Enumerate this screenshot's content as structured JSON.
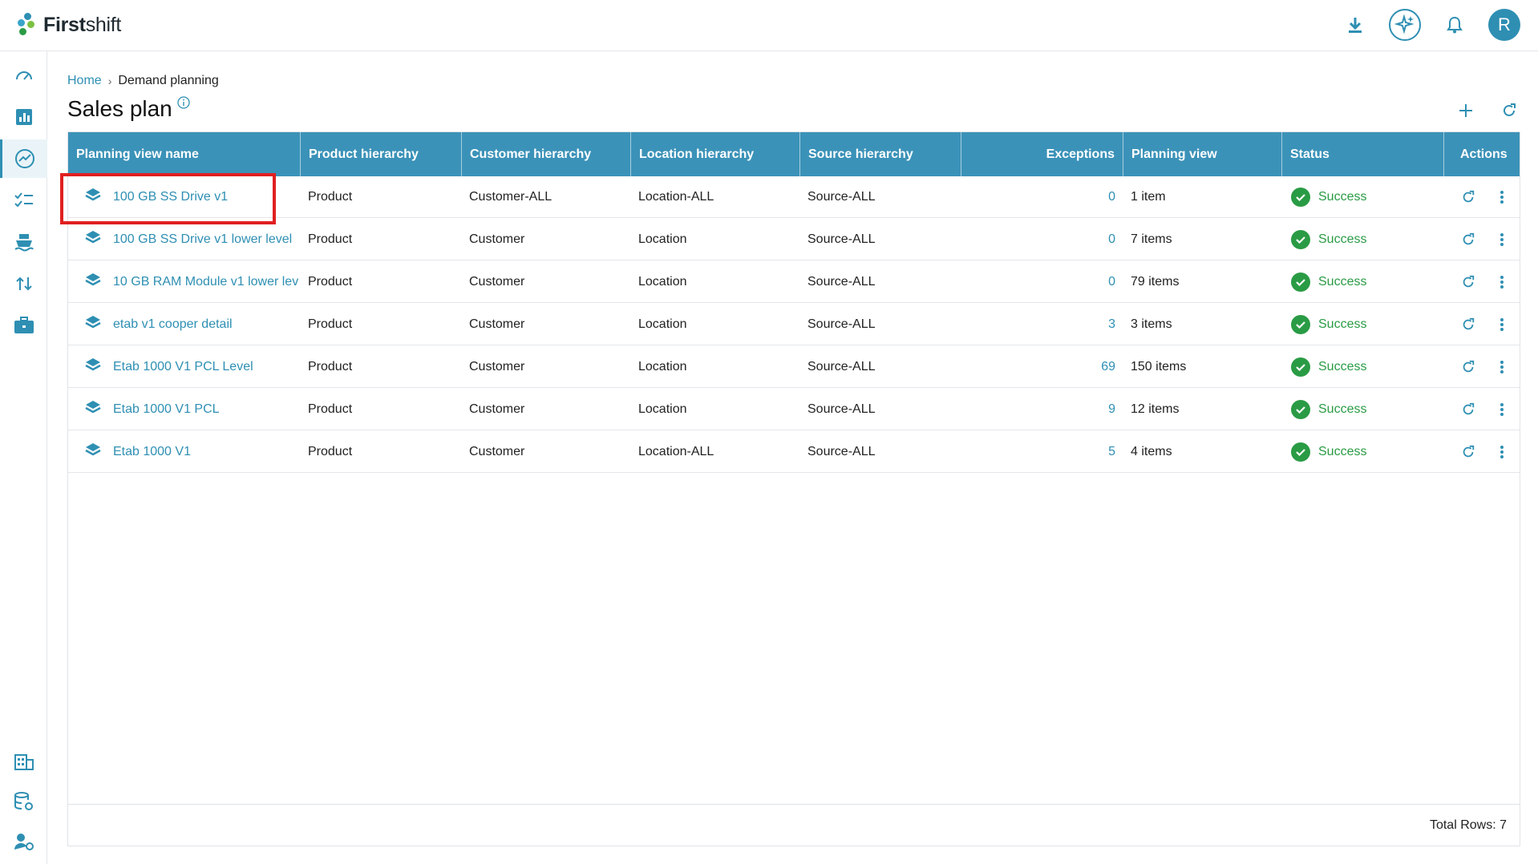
{
  "app": {
    "name_bold": "First",
    "name_rest": "shift",
    "avatar_initial": "R"
  },
  "topbar": {
    "icons": [
      "download-icon",
      "ai-sparkle-icon",
      "bell-icon"
    ]
  },
  "sidebar": {
    "items": [
      {
        "name": "dashboard-icon",
        "active": false
      },
      {
        "name": "bar-chart-icon",
        "active": false
      },
      {
        "name": "trend-chart-icon",
        "active": true
      },
      {
        "name": "checklist-icon",
        "active": false
      },
      {
        "name": "ship-icon",
        "active": false
      },
      {
        "name": "swap-icon",
        "active": false
      },
      {
        "name": "briefcase-icon",
        "active": false
      },
      {
        "name": "building-icon",
        "active": false
      },
      {
        "name": "database-settings-icon",
        "active": false
      },
      {
        "name": "user-settings-icon",
        "active": false
      }
    ]
  },
  "breadcrumb": {
    "home": "Home",
    "separator": "›",
    "current": "Demand planning"
  },
  "page": {
    "title": "Sales plan"
  },
  "table": {
    "columns": {
      "name": "Planning view name",
      "product": "Product hierarchy",
      "customer": "Customer hierarchy",
      "location": "Location hierarchy",
      "source": "Source hierarchy",
      "exceptions": "Exceptions",
      "view": "Planning view",
      "status": "Status",
      "actions": "Actions"
    },
    "rows": [
      {
        "name": "100 GB SS Drive v1",
        "product": "Product",
        "customer": "Customer-ALL",
        "location": "Location-ALL",
        "source": "Source-ALL",
        "exceptions": "0",
        "view": "1 item",
        "status": "Success"
      },
      {
        "name": "100 GB SS Drive v1 lower level",
        "product": "Product",
        "customer": "Customer",
        "location": "Location",
        "source": "Source-ALL",
        "exceptions": "0",
        "view": "7 items",
        "status": "Success"
      },
      {
        "name": "10 GB RAM Module v1 lower lev",
        "product": "Product",
        "customer": "Customer",
        "location": "Location",
        "source": "Source-ALL",
        "exceptions": "0",
        "view": "79 items",
        "status": "Success"
      },
      {
        "name": "etab v1 cooper detail",
        "product": "Product",
        "customer": "Customer",
        "location": "Location",
        "source": "Source-ALL",
        "exceptions": "3",
        "view": "3 items",
        "status": "Success"
      },
      {
        "name": "Etab 1000 V1 PCL Level",
        "product": "Product",
        "customer": "Customer",
        "location": "Location",
        "source": "Source-ALL",
        "exceptions": "69",
        "view": "150 items",
        "status": "Success"
      },
      {
        "name": "Etab 1000 V1 PCL",
        "product": "Product",
        "customer": "Customer",
        "location": "Location",
        "source": "Source-ALL",
        "exceptions": "9",
        "view": "12 items",
        "status": "Success"
      },
      {
        "name": "Etab 1000 V1",
        "product": "Product",
        "customer": "Customer",
        "location": "Location-ALL",
        "source": "Source-ALL",
        "exceptions": "5",
        "view": "4 items",
        "status": "Success"
      }
    ],
    "footer": "Total Rows: 7"
  },
  "colors": {
    "accent": "#2e8fb3",
    "header": "#3b92b8",
    "success": "#2a9b45",
    "highlight": "#e02020"
  }
}
